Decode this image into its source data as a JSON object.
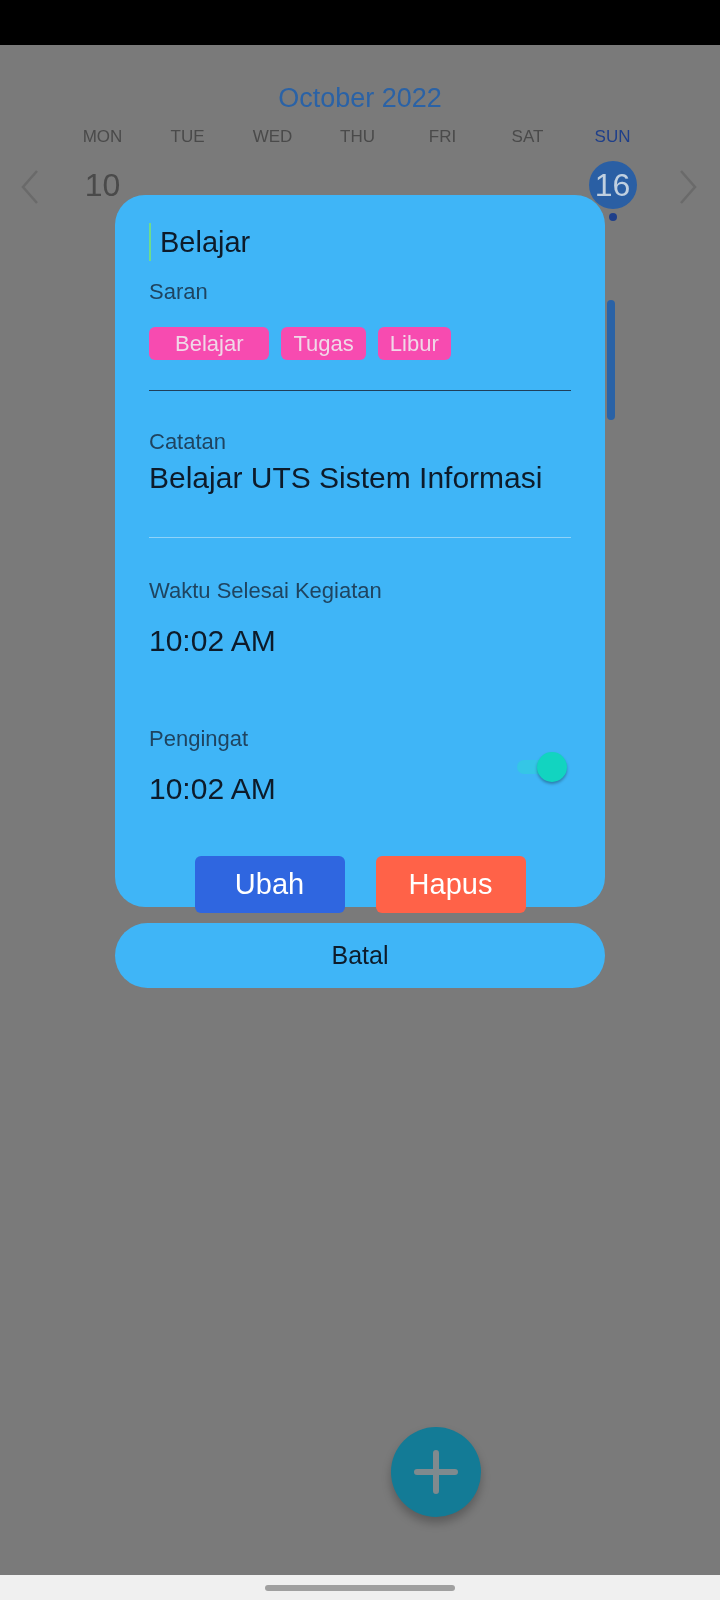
{
  "calendar": {
    "title": "October 2022",
    "days": [
      {
        "weekday": "MON",
        "date": "10",
        "selected": false
      },
      {
        "weekday": "TUE",
        "selected": false
      },
      {
        "weekday": "WED",
        "selected": false
      },
      {
        "weekday": "THU",
        "selected": false
      },
      {
        "weekday": "FRI",
        "selected": false
      },
      {
        "weekday": "SAT",
        "selected": false
      },
      {
        "weekday": "SUN",
        "date": "16",
        "selected": true,
        "has_event": true
      }
    ]
  },
  "dialog": {
    "title": "Belajar",
    "suggestions_label": "Saran",
    "suggestions": [
      "Belajar",
      "Tugas",
      "Libur"
    ],
    "note": {
      "label": "Catatan",
      "value": "Belajar UTS Sistem Informasi"
    },
    "end_time": {
      "label": "Waktu Selesai Kegiatan",
      "value": "10:02 AM"
    },
    "reminder": {
      "label": "Pengingat",
      "value": "10:02 AM",
      "on": true
    },
    "buttons": [
      {
        "label": "Ubah",
        "kind": "edit"
      },
      {
        "label": "Hapus",
        "kind": "delete"
      }
    ],
    "cancel": "Batal"
  }
}
